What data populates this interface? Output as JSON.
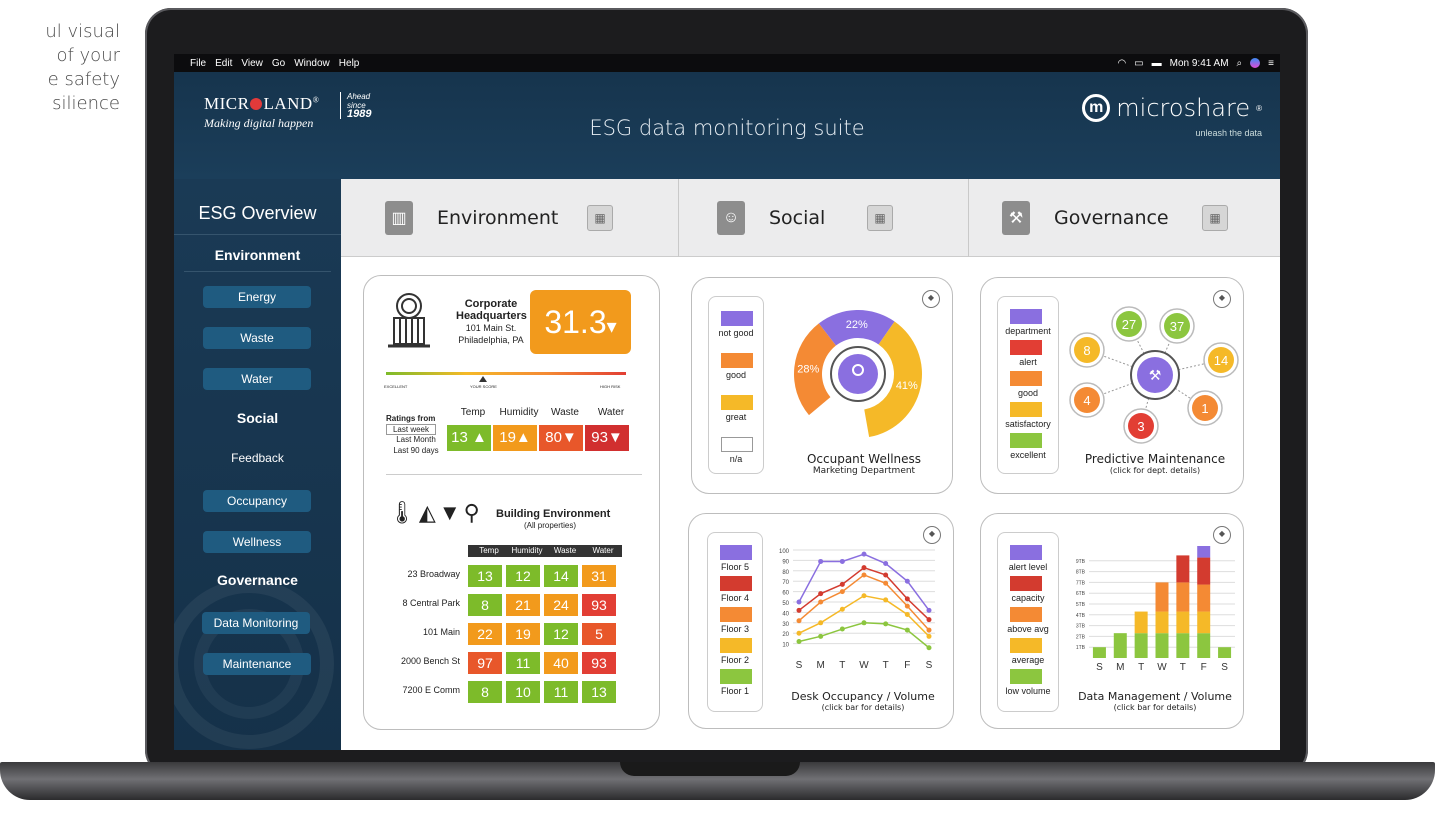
{
  "promo_text": [
    "ul visual",
    "of your",
    "e safety",
    "silience"
  ],
  "menubar": {
    "items": [
      "File",
      "Edit",
      "View",
      "Go",
      "Window",
      "Help"
    ],
    "clock": "Mon 9:41 AM"
  },
  "header": {
    "microland": "MICR",
    "microland2": "LAND",
    "registered": "®",
    "tagline": "Making digital happen",
    "ahead": "Ahead",
    "since": "since",
    "year": "1989",
    "title": "ESG data monitoring suite",
    "microshare": "microshare",
    "microshare_reg": "®",
    "microshare_tag": "unleash the data"
  },
  "sidebar": {
    "title": "ESG Overview",
    "env": "Environment",
    "energy": "Energy",
    "waste": "Waste",
    "water": "Water",
    "social": "Social",
    "feedback": "Feedback",
    "occupancy": "Occupancy",
    "wellness": "Wellness",
    "governance": "Governance",
    "data_monitoring": "Data Monitoring",
    "maintenance": "Maintenance"
  },
  "tabs": {
    "env": "Environment",
    "social": "Social",
    "gov": "Governance"
  },
  "hq": {
    "name1": "Corporate",
    "name2": "Headquarters",
    "addr1": "101 Main St.",
    "addr2": "Philadelphia, PA",
    "score": "31.3",
    "score_arrow": "▾",
    "scale_left": "EXCELLENT",
    "scale_mid": "YOUR SCORE",
    "scale_right": "HIGH RISK",
    "ratings_from": "Ratings from",
    "last_week": "Last week",
    "last_month": "Last Month",
    "last_90": "Last 90 days",
    "cols": [
      "Temp",
      "Humidity",
      "Waste",
      "Water"
    ],
    "vals": [
      "13 ▲",
      "19▲",
      "80▼",
      "93▼"
    ],
    "colors": [
      "#7dbb2a",
      "#f29a1c",
      "#e8572a",
      "#d12f2f"
    ]
  },
  "building": {
    "title": "Building Environment",
    "sub": "(All properties)",
    "cols": [
      "Temp",
      "Humidity",
      "Waste",
      "Water"
    ],
    "rows": [
      {
        "name": "23 Broadway",
        "vals": [
          "13",
          "12",
          "14",
          "31"
        ],
        "c": [
          "#7dbb2a",
          "#7dbb2a",
          "#7dbb2a",
          "#f29a1c"
        ]
      },
      {
        "name": "8 Central Park",
        "vals": [
          "8",
          "21",
          "24",
          "93"
        ],
        "c": [
          "#7dbb2a",
          "#f29a1c",
          "#f29a1c",
          "#e23e34"
        ]
      },
      {
        "name": "101 Main",
        "vals": [
          "22",
          "19",
          "12",
          "5"
        ],
        "c": [
          "#f29a1c",
          "#f29a1c",
          "#7dbb2a",
          "#e8572a"
        ]
      },
      {
        "name": "2000 Bench St",
        "vals": [
          "97",
          "11",
          "40",
          "93"
        ],
        "c": [
          "#e8572a",
          "#7dbb2a",
          "#f29a1c",
          "#e23e34"
        ]
      },
      {
        "name": "7200 E Comm",
        "vals": [
          "8",
          "10",
          "11",
          "13"
        ],
        "c": [
          "#7dbb2a",
          "#7dbb2a",
          "#7dbb2a",
          "#7dbb2a"
        ]
      }
    ]
  },
  "wellness": {
    "legend": [
      "not good",
      "good",
      "great",
      "n/a"
    ],
    "legend_colors": [
      "#8a6fe0",
      "#f48a34",
      "#f5b928",
      "#ffffff"
    ],
    "pct": [
      {
        "label": "22",
        "value": 22
      },
      {
        "label": "28",
        "value": 28
      },
      {
        "label": "41",
        "value": 41
      }
    ],
    "pct_unit": "%",
    "title": "Occupant Wellness",
    "sub": "Marketing Department"
  },
  "maint": {
    "legend": [
      "department",
      "alert",
      "good",
      "satisfactory",
      "excellent"
    ],
    "legend_colors": [
      "#8a6fe0",
      "#e23e34",
      "#f48a34",
      "#f5b928",
      "#8cc63f"
    ],
    "nodes": [
      "27",
      "37",
      "8",
      "14",
      "4",
      "1",
      "3"
    ],
    "title": "Predictive Maintenance",
    "sub": "(click for dept. details)"
  },
  "desk": {
    "legend": [
      "Floor 5",
      "Floor 4",
      "Floor 3",
      "Floor 2",
      "Floor 1"
    ],
    "legend_colors": [
      "#8a6fe0",
      "#d33b2f",
      "#f48a34",
      "#f5b928",
      "#8cc63f"
    ],
    "title": "Desk Occupancy / Volume",
    "sub": "(click bar for details)"
  },
  "datamgmt": {
    "legend": [
      "alert level",
      "capacity",
      "above avg",
      "average",
      "low volume"
    ],
    "legend_colors": [
      "#8a6fe0",
      "#d33b2f",
      "#f48a34",
      "#f5b928",
      "#8cc63f"
    ],
    "title": "Data Management / Volume",
    "sub": "(click bar for details)"
  },
  "chart_data": [
    {
      "type": "line",
      "title": "Desk Occupancy / Volume",
      "categories": [
        "S",
        "M",
        "T",
        "W",
        "T",
        "F",
        "S"
      ],
      "yticks": [
        "100",
        "90",
        "80",
        "70",
        "60",
        "50",
        "40",
        "30",
        "20",
        "10"
      ],
      "ylim": [
        0,
        100
      ],
      "series": [
        {
          "name": "Floor 5",
          "values": [
            50,
            89,
            89,
            96,
            87,
            70,
            42
          ]
        },
        {
          "name": "Floor 4",
          "values": [
            42,
            58,
            67,
            83,
            76,
            53,
            33
          ]
        },
        {
          "name": "Floor 3",
          "values": [
            32,
            50,
            60,
            76,
            68,
            46,
            23
          ]
        },
        {
          "name": "Floor 2",
          "values": [
            20,
            30,
            43,
            56,
            52,
            38,
            17
          ]
        },
        {
          "name": "Floor 1",
          "values": [
            12,
            17,
            24,
            30,
            29,
            23,
            6
          ]
        }
      ]
    },
    {
      "type": "bar",
      "title": "Data Management / Volume",
      "categories": [
        "S",
        "M",
        "T",
        "W",
        "T",
        "F",
        "S"
      ],
      "yticks": [
        "9TB",
        "8TB",
        "7TB",
        "6TB",
        "5TB",
        "4TB",
        "3TB",
        "2TB",
        "1TB"
      ],
      "ylim": [
        0,
        10
      ],
      "series": [
        {
          "name": "low volume",
          "values": [
            1,
            2.3,
            2.3,
            2.3,
            2.3,
            2.3,
            1
          ]
        },
        {
          "name": "average",
          "values": [
            0,
            0,
            2,
            2,
            2,
            2,
            0
          ]
        },
        {
          "name": "above avg",
          "values": [
            0,
            0,
            0,
            2.7,
            2.7,
            2.5,
            0
          ]
        },
        {
          "name": "capacity",
          "values": [
            0,
            0,
            0,
            0,
            2.5,
            2.5,
            0
          ]
        },
        {
          "name": "alert level",
          "values": [
            0,
            0,
            0,
            0,
            0,
            1.3,
            0
          ]
        }
      ]
    }
  ]
}
